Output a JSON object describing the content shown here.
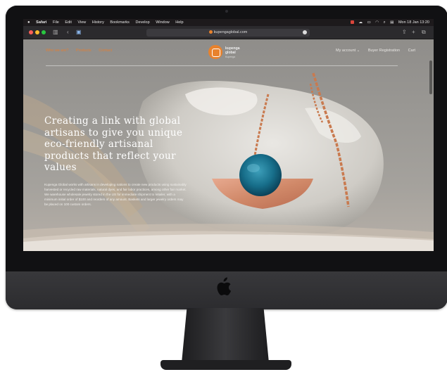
{
  "menubar": {
    "items": [
      "Safari",
      "File",
      "Edit",
      "View",
      "History",
      "Bookmarks",
      "Develop",
      "Window",
      "Help"
    ],
    "clock": "Mon 18 Jan 13:20"
  },
  "browser": {
    "url": "kupengaglobal.com"
  },
  "site": {
    "nav_left": [
      "Who we are?",
      "Products",
      "Contact"
    ],
    "logo_text": [
      "kupenga",
      "global"
    ],
    "logo_sub": "Kupenga",
    "nav_right": [
      "My account ⌄",
      "Buyer Registration",
      "Cart"
    ],
    "headline": "Creating a link with global artisans to give you unique eco-friendly artisanal products that reflect your values",
    "body_paragraphs": [
      "Kupenga Global works with artisans in developing nations to create new products using sustainably harvested or recycled raw materials, natural dyes, and fair labor practices, among other fair market.",
      "We warehouse wholesale jewelry stored in the US for immediate shipment to retailer, with a minimum initial order of $100 and reorders of any amount. Baskets and larger jewelry orders may be placed on 100 custom orders."
    ]
  },
  "colors": {
    "accent": "#e07f36",
    "bezel": "#111113",
    "chin": "#333336"
  }
}
